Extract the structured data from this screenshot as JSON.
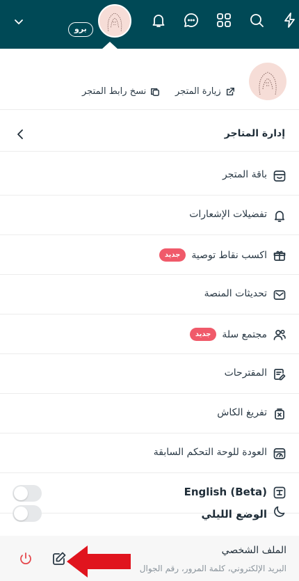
{
  "topbar": {
    "badge": "برو",
    "icons": [
      "chevron-down-icon",
      "bell-icon",
      "chat-icon",
      "apps-grid-icon",
      "search-icon",
      "lightning-icon"
    ]
  },
  "store": {
    "visit_label": "زيارة المتجر",
    "copy_link_label": "نسخ رابط المتجر"
  },
  "section": {
    "title": "إدارة المتاجر"
  },
  "menu": [
    {
      "label": "باقة المتجر",
      "icon": "store-package-icon"
    },
    {
      "label": "تفضيلات الإشعارات",
      "icon": "bell-icon"
    },
    {
      "label": "اكسب نقاط توصية",
      "icon": "gift-icon",
      "badge": "جديد"
    },
    {
      "label": "تحديثات المنصة",
      "icon": "mail-icon"
    },
    {
      "label": "مجتمع سلة",
      "icon": "community-icon",
      "badge": "جديد"
    },
    {
      "label": "المقترحات",
      "icon": "suggestions-icon"
    },
    {
      "label": "تفريغ الكاش",
      "icon": "clear-cache-icon"
    },
    {
      "label": "العودة للوحة التحكم السابقة",
      "icon": "dashboard-icon"
    }
  ],
  "toggles": [
    {
      "label": "English (Beta)",
      "icon": "language-icon",
      "on": false
    },
    {
      "label": "الوضع الليلي",
      "icon": "moon-icon",
      "on": false
    }
  ],
  "profile": {
    "title": "الملف الشخصي",
    "subtitle": "البريد الإلكتروني، كلمة المرور، رقم الجوال"
  },
  "colors": {
    "topbar": "#004956",
    "badge_new": "#f05a6a",
    "logout": "#e5484d",
    "annotation_arrow": "#e0141e"
  }
}
